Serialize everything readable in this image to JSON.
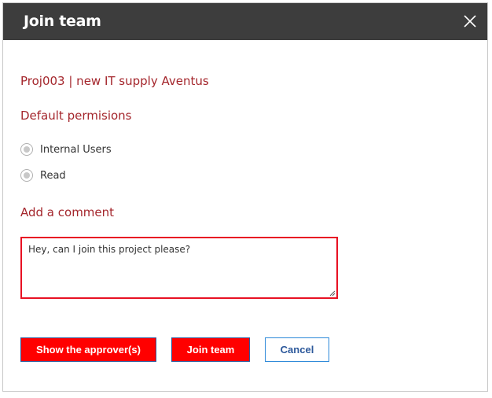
{
  "dialog": {
    "title": "Join team",
    "project_name": "Proj003 | new IT supply Aventus",
    "permissions_label": "Default permisions",
    "radios": [
      {
        "label": "Internal Users"
      },
      {
        "label": "Read"
      }
    ],
    "comment_label": "Add a comment",
    "comment_value": "Hey, can I join this project please?",
    "buttons": {
      "show_approvers": "Show the approver(s)",
      "join_team": "Join team",
      "cancel": "Cancel"
    }
  },
  "icons": {
    "close": "close-icon",
    "resize": "resize-grip-icon"
  },
  "colors": {
    "titlebar": "#3d3d3d",
    "section_label": "#a4262c",
    "primary_button": "#ff0000",
    "comment_border": "#e81123",
    "secondary_border": "#2b88d8"
  }
}
